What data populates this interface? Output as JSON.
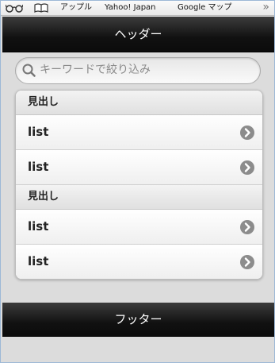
{
  "bookmarks": {
    "items": [
      {
        "icon": "reading-glasses-icon"
      },
      {
        "icon": "open-book-icon"
      },
      {
        "label": "アップル"
      },
      {
        "label": "Yahoo! Japan"
      },
      {
        "label": "Google マップ"
      }
    ],
    "more_label": "»"
  },
  "header": {
    "title": "ヘッダー"
  },
  "search": {
    "placeholder": "キーワードで絞り込み",
    "value": ""
  },
  "list": {
    "groups": [
      {
        "heading": "見出し",
        "items": [
          {
            "label": "list"
          },
          {
            "label": "list"
          }
        ]
      },
      {
        "heading": "見出し",
        "items": [
          {
            "label": "list"
          },
          {
            "label": "list"
          }
        ]
      }
    ]
  },
  "footer": {
    "title": "フッター"
  },
  "colors": {
    "bar_dark": "#111111",
    "page_bg": "#dcdcdc",
    "arrow_gray": "#8c8c8c"
  }
}
